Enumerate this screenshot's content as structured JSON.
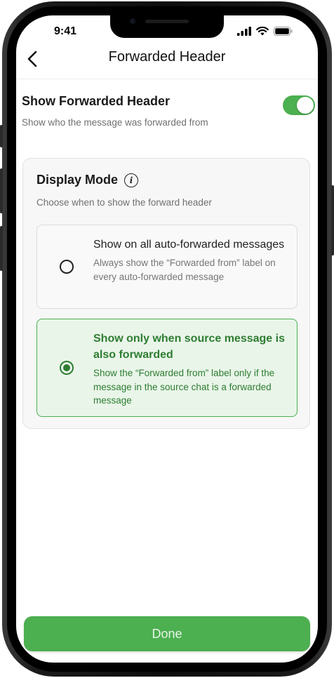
{
  "status_bar": {
    "time": "9:41"
  },
  "nav": {
    "title": "Forwarded Header"
  },
  "setting": {
    "title": "Show Forwarded Header",
    "subtitle": "Show who the message was forwarded from",
    "toggle_on": true
  },
  "display_mode": {
    "title": "Display Mode",
    "subtitle": "Choose when to show the forward header",
    "options": [
      {
        "title": "Show on all auto-forwarded messages",
        "description": "Always show the “Forwarded from” label on every auto-forwarded message",
        "selected": false
      },
      {
        "title": "Show only when source message is also forwarded",
        "description": "Show the “Forwarded from” label only if the message in the source chat is a forwarded message",
        "selected": true
      }
    ]
  },
  "footer": {
    "done_label": "Done"
  },
  "colors": {
    "accent": "#4caf50",
    "accent_dark": "#2e7d32",
    "selected_bg": "#e9f5e9"
  }
}
